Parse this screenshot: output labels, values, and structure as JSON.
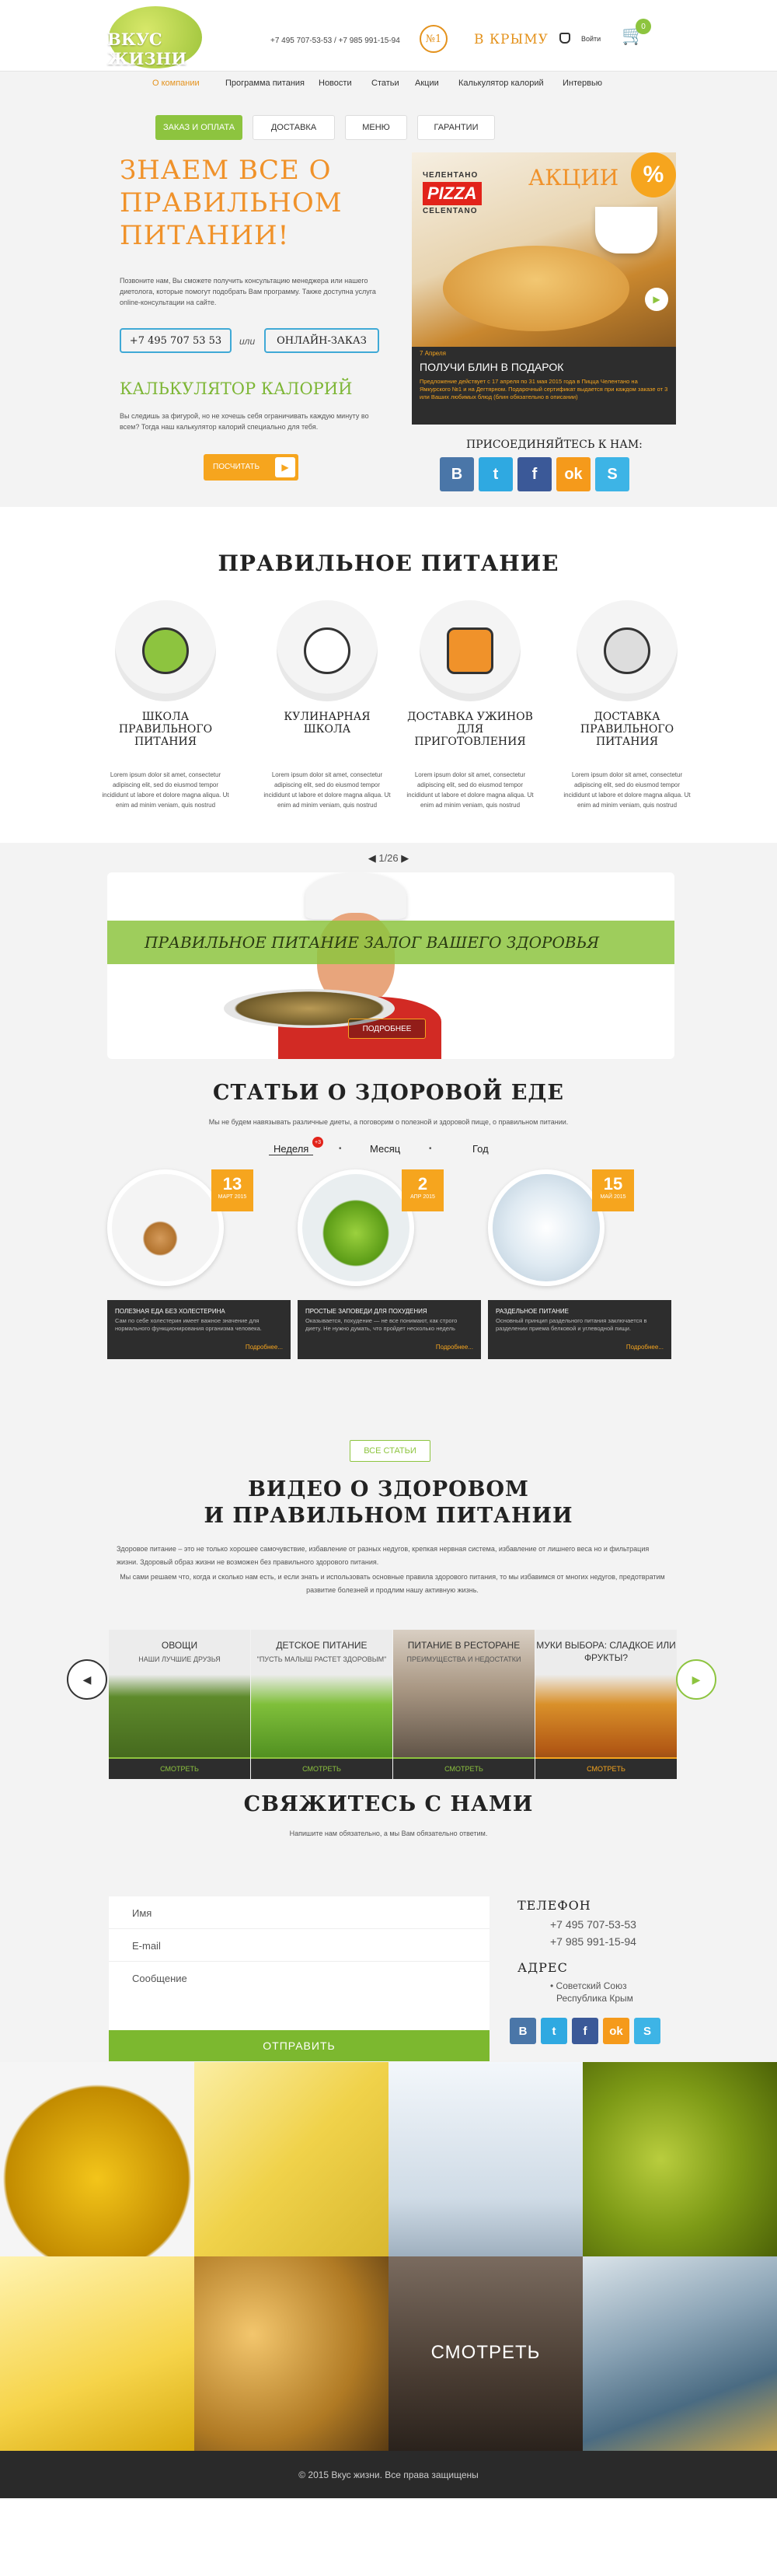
{
  "header": {
    "logo": "ВКУС ЖИЗНИ",
    "phones": "+7 495 707-53-53 / +7 985 991-15-94",
    "badge": "№1",
    "region": "В КРЫМУ",
    "login": "Войти",
    "cart_count": "0"
  },
  "nav": {
    "items": [
      "О компании",
      "Программа питания",
      "Новости",
      "Статьи",
      "Акции",
      "Калькулятор калорий",
      "Интервью"
    ]
  },
  "subtabs": [
    "ЗАКАЗ И ОПЛАТА",
    "ДОСТАВКА",
    "МЕНЮ",
    "ГАРАНТИИ"
  ],
  "hero": {
    "title": "ЗНАЕМ ВСЕ О ПРАВИЛЬНОМ ПИТАНИИ!",
    "text": "Позвоните нам, Вы сможете получить консультацию менеджера или нашего диетолога, которые помогут подобрать Вам программу. Также доступна услуга online-консультации на сайте.",
    "phone": "+7 495 707 53 53",
    "or": "или",
    "order": "ОНЛАЙН-ЗАКАЗ",
    "calc_title": "КАЛЬКУЛЯТОР КАЛОРИЙ",
    "calc_text": "Вы следишь за фигурой, но не хочешь себя ограничивать каждую минуту во всем? Тогда наш калькулятор калорий специально для тебя.",
    "calc_button": "ПОСЧИТАТЬ"
  },
  "promo": {
    "title": "АКЦИИ",
    "pct": "%",
    "brand_top": "ЧЕЛЕНТАНО",
    "brand_mid": "PIZZA",
    "brand_bot": "CELENTANO",
    "date": "7 Апреля",
    "caption": "ПОЛУЧИ БЛИН В ПОДАРОК",
    "text": "Предложение действует с 17 апреля по 31 мая 2015 года в Пицца Челентано на Ямкурского №1 и на Дегтярном. Подарочный сертификат выдается при каждом заказе от 3 или Ваших любимых блюд (блин обязательно в описании)"
  },
  "social": {
    "title": "ПРИСОЕДИНЯЙТЕСЬ К НАМ:",
    "icons": [
      "В",
      "t",
      "f",
      "ok",
      "S"
    ],
    "colors": [
      "#4a76a8",
      "#2fa9e1",
      "#3b5998",
      "#f59a1b",
      "#3db4e6"
    ]
  },
  "nutrition": {
    "title": "ПРАВИЛЬНОЕ ПИТАНИЕ",
    "items": [
      {
        "title": "ШКОЛА ПРАВИЛЬНОГО ПИТАНИЯ",
        "text": "Lorem ipsum dolor sit amet, consectetur adipiscing elit, sed do eiusmod tempor incididunt ut labore et dolore magna aliqua. Ut enim ad minim veniam, quis nostrud"
      },
      {
        "title": "КУЛИНАРНАЯ ШКОЛА",
        "text": "Lorem ipsum dolor sit amet, consectetur adipiscing elit, sed do eiusmod tempor incididunt ut labore et dolore magna aliqua. Ut enim ad minim veniam, quis nostrud"
      },
      {
        "title": "ДОСТАВКА УЖИНОВ ДЛЯ ПРИГОТОВЛЕНИЯ",
        "text": "Lorem ipsum dolor sit amet, consectetur adipiscing elit, sed do eiusmod tempor incididunt ut labore et dolore magna aliqua. Ut enim ad minim veniam, quis nostrud"
      },
      {
        "title": "ДОСТАВКА ПРАВИЛЬНОГО ПИТАНИЯ",
        "text": "Lorem ipsum dolor sit amet, consectetur adipiscing elit, sed do eiusmod tempor incididunt ut labore et dolore magna aliqua. Ut enim ad minim veniam, quis nostrud"
      }
    ]
  },
  "slider": {
    "counter": "1/26",
    "banner": "ПРАВИЛЬНОЕ ПИТАНИЕ ЗАЛОГ ВАШЕГО ЗДОРОВЬЯ",
    "button": "ПОДРОБНЕЕ"
  },
  "articles": {
    "title": "СТАТЬИ О ЗДОРОВОЙ ЕДЕ",
    "subtitle": "Мы не будем навязывать различные диеты, а поговорим о полезной и здоровой пище, о правильном питании.",
    "tabs": [
      "Неделя",
      "Месяц",
      "Год"
    ],
    "tab_badge": "+3",
    "cards": [
      {
        "day": "13",
        "month": "МАРТ 2015",
        "title": "ПОЛЕЗНАЯ ЕДА БЕЗ ХОЛЕСТЕРИНА",
        "text": "Сам по себе холестерин имеет важное значение для нормального функционирования организма человека.",
        "more": "Подробнее..."
      },
      {
        "day": "2",
        "month": "АПР 2015",
        "title": "ПРОСТЫЕ ЗАПОВЕДИ ДЛЯ ПОХУДЕНИЯ",
        "text": "Оказывается, похудение — не все понимают, как строго диету. Не нужно думать, что пройдет несколько недель",
        "more": "Подробнее..."
      },
      {
        "day": "15",
        "month": "МАЙ 2015",
        "title": "РАЗДЕЛЬНОЕ ПИТАНИЕ",
        "text": "Основный принцип раздельного питания заключается в разделении приема белковой и углеводной пищи.",
        "more": "Подробнее..."
      }
    ],
    "all": "ВСЕ СТАТЬИ"
  },
  "video": {
    "title1": "ВИДЕО О ЗДОРОВОМ",
    "title2": "И ПРАВИЛЬНОМ ПИТАНИИ",
    "p1": "Здоровое питание – это не только хорошее самочувствие, избавление от разных недугов, крепкая нервная система, избавление от лишнего веса но и фильтрация жизни. Здоровый образ жизни не возможен без правильного здорового питания.",
    "p2": "Мы сами решаем что, когда и сколько нам есть, и если знать и использовать основные правила здорового питания, то мы избавимся от многих недугов, предотвратим развитие болезней и продлим нашу активную жизнь.",
    "items": [
      {
        "title": "ОВОЩИ",
        "sub": "НАШИ ЛУЧШИЕ ДРУЗЬЯ",
        "btn": "СМОТРЕТЬ"
      },
      {
        "title": "ДЕТСКОЕ ПИТАНИЕ",
        "sub": "\"ПУСТЬ МАЛЫШ РАСТЕТ ЗДОРОВЫМ\"",
        "btn": "СМОТРЕТЬ"
      },
      {
        "title": "ПИТАНИЕ В РЕСТОРАНЕ",
        "sub": "ПРЕИМУЩЕСТВА И НЕДОСТАТКИ",
        "btn": "СМОТРЕТЬ"
      },
      {
        "title": "МУКИ ВЫБОРА: СЛАДКОЕ ИЛИ ФРУКТЫ?",
        "sub": "",
        "btn": "СМОТРЕТЬ"
      }
    ]
  },
  "contact": {
    "title": "СВЯЖИТЕСЬ С НАМИ",
    "subtitle": "Напишите нам обязательно, а мы Вам обязательно ответим.",
    "name_ph": "Имя",
    "email_ph": "E-mail",
    "msg_ph": "Сообщение",
    "send": "ОТПРАВИТЬ",
    "phone_label": "ТЕЛЕФОН",
    "phone1": "+7 495 707-53-53",
    "phone2": "+7 985 991-15-94",
    "addr_label": "АДРЕС",
    "addr1": "• Советский Союз",
    "addr2": "Республика Крым"
  },
  "gallery": {
    "watch": "СМОТРЕТЬ"
  },
  "footer": {
    "copyright": "© 2015 Вкус жизни. Все права защищены"
  }
}
